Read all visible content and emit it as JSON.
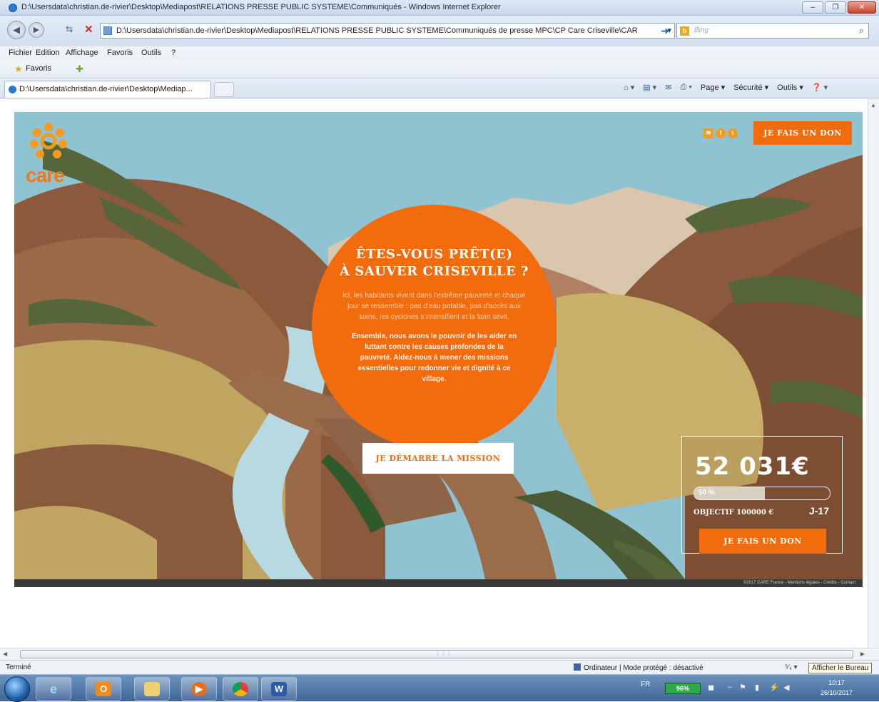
{
  "window": {
    "title": "D:\\Usersdata\\christian.de-rivier\\Desktop\\Mediapost\\RELATIONS PRESSE PUBLIC SYSTEME\\Communiqués - Windows Internet Explorer",
    "address": "D:\\Usersdata\\christian.de-rivier\\Desktop\\Mediapost\\RELATIONS PRESSE PUBLIC SYSTEME\\Communiqués de presse MPC\\CP Care Criseville\\CAR",
    "search_placeholder": "Bing",
    "tab_title": "D:\\Usersdata\\christian.de-rivier\\Desktop\\Mediap...",
    "favorites_label": "Favoris",
    "menu": [
      "Fichier",
      "Edition",
      "Affichage",
      "Favoris",
      "Outils",
      "?"
    ],
    "commands": {
      "page": "Page ▾",
      "security": "Sécurité ▾",
      "tools": "Outils ▾"
    }
  },
  "page": {
    "brand": "care",
    "donate_top": "JE FAIS UN DON",
    "headline_line1": "ÊTES-VOUS PRÊT(E)",
    "headline_line2": "À SAUVER CRISEVILLE ?",
    "intro": "Ici, les habitants vivent dans l'extrême pauvreté et chaque jour se ressemble : pas d'eau potable, pas d'accès aux soins, les cyclones s'intensifient et la faim sévit.",
    "mission_text": "Ensemble, nous avons le pouvoir de les aider en luttant contre les causes profondes de la pauvreté. Aidez-nous à mener des missions essentielles pour redonner vie et dignité à ce village.",
    "start_button": "JE DÉMARRE LA MISSION",
    "fund_amount": "52 031€",
    "fund_percent_label": "50 %",
    "fund_progress": 0.52,
    "objective": "OBJECTIF 100000 €",
    "days_left": "J-17",
    "donate_bottom": "JE FAIS UN DON",
    "footer": "©2017 CARE France - Mentions légales - Crédits - Contact"
  },
  "status": {
    "left": "Terminé",
    "zone": "Ordinateur | Mode protégé : désactivé",
    "zoom": "⁵⁄₄ ▾",
    "tooltip": "Afficher le Bureau"
  },
  "taskbar": {
    "battery": "96%",
    "time": "10:17",
    "date": "26/10/2017",
    "lang": "FR"
  },
  "colors": {
    "accent": "#f26c0d",
    "sky": "#8fc3d2"
  }
}
